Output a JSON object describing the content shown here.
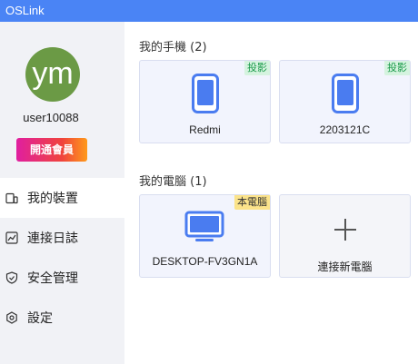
{
  "app": {
    "title": "OSLink"
  },
  "user": {
    "avatar_text": "ym",
    "name": "user10088",
    "vip_label": "開通會員"
  },
  "nav": {
    "items": [
      {
        "label": "我的裝置",
        "icon": "devices-icon",
        "active": true
      },
      {
        "label": "連接日誌",
        "icon": "chart-log-icon",
        "active": false
      },
      {
        "label": "安全管理",
        "icon": "shield-icon",
        "active": false
      },
      {
        "label": "設定",
        "icon": "gear-icon",
        "active": false
      }
    ]
  },
  "phones": {
    "title": "我的手機 (2)",
    "items": [
      {
        "name": "Redmi",
        "badge": "投影",
        "icon": "phone-icon"
      },
      {
        "name": "2203121C",
        "badge": "投影",
        "icon": "phone-icon"
      }
    ]
  },
  "computers": {
    "title": "我的電腦 (1)",
    "items": [
      {
        "name": "DESKTOP-FV3GN1A",
        "badge": "本電腦",
        "icon": "monitor-icon"
      }
    ],
    "add_label": "連接新電腦",
    "add_icon": "plus-icon"
  },
  "colors": {
    "titlebar": "#4a84f5",
    "avatar": "#6b9a45",
    "device_blue": "#4a7cf0",
    "cast_badge_bg": "#d5f3df",
    "cast_badge_text": "#1a9a4a",
    "local_badge_bg": "#fbe38a"
  }
}
